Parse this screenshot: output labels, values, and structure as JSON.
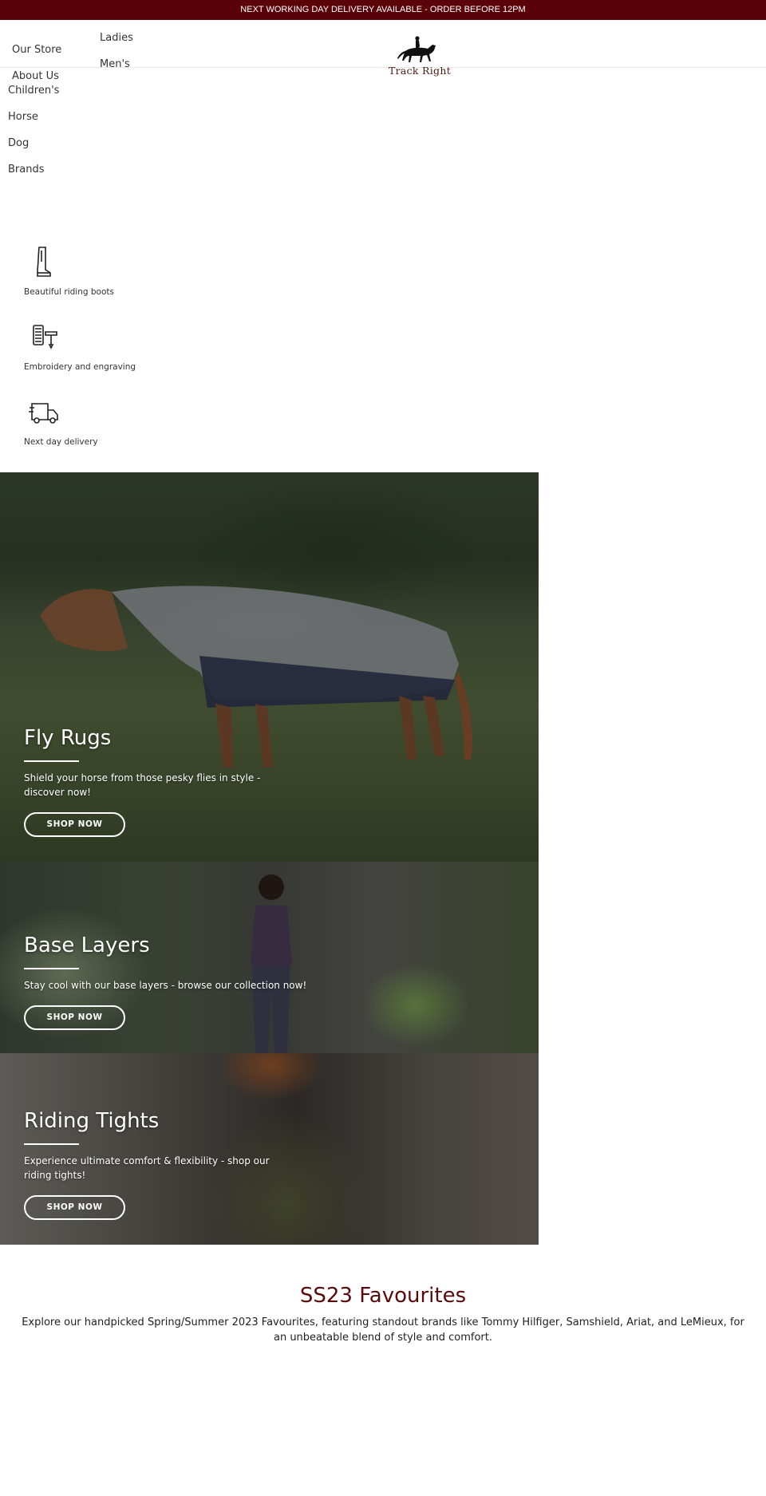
{
  "announcement": "NEXT WORKING DAY DELIVERY AVAILABLE - ORDER BEFORE 12PM",
  "nav": {
    "our_store": "Our Store",
    "about_us": "About Us",
    "ladies": "Ladies",
    "mens": "Men's",
    "childrens": "Children's",
    "horse": "Horse",
    "dog": "Dog",
    "brands": "Brands"
  },
  "logo": {
    "text": "Track Right",
    "icon": "horse-rider-logo"
  },
  "features": [
    {
      "icon": "riding-boot-icon",
      "text": "Beautiful riding boots"
    },
    {
      "icon": "embroidery-icon",
      "text": "Embroidery and engraving"
    },
    {
      "icon": "delivery-van-icon",
      "text": "Next day delivery"
    }
  ],
  "banners": [
    {
      "title": "Fly Rugs",
      "text": "Shield your horse from those pesky flies in style - discover now!",
      "button": "SHOP NOW"
    },
    {
      "title": "Base Layers",
      "text": "Stay cool with our base layers - browse our collection now!",
      "button": "SHOP NOW"
    },
    {
      "title": "Riding Tights",
      "text": "Experience ultimate comfort & flexibility - shop our riding tights!",
      "button": "SHOP NOW"
    }
  ],
  "favourites": {
    "title": "SS23 Favourites",
    "text": "Explore our handpicked Spring/Summer 2023 Favourites, featuring standout brands like Tommy Hilfiger, Samshield, Ariat, and LeMieux, for an unbeatable blend of style and comfort."
  },
  "colors": {
    "brand": "#5a0208",
    "title": "#5a0a0a"
  }
}
